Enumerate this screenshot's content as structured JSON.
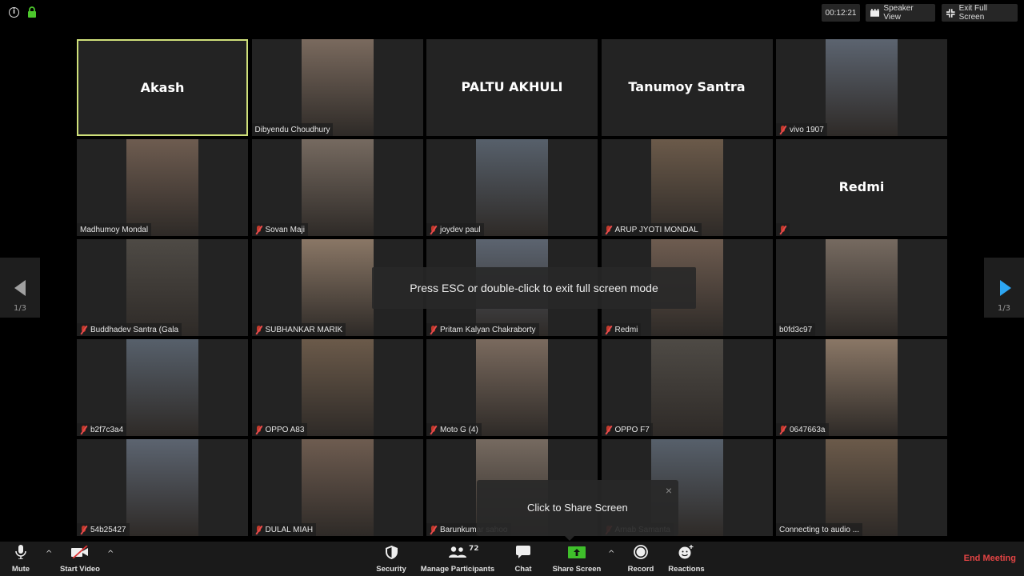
{
  "top_bar": {
    "info_icon": "info-icon",
    "lock_icon": "lock-icon",
    "timer": "00:12:21",
    "speaker_view_label": "Speaker View",
    "exit_full_screen_label": "Exit Full Screen"
  },
  "gallery": {
    "page_indicator_left": "1/3",
    "page_indicator_right": "1/3",
    "tiles": [
      {
        "name": "Akash",
        "video": false,
        "muted": false,
        "active_speaker": true
      },
      {
        "name": "Dibyendu Choudhury",
        "video": true,
        "muted": false
      },
      {
        "name": "PALTU AKHULI",
        "video": false,
        "muted": false
      },
      {
        "name": "Tanumoy Santra",
        "video": false,
        "muted": false
      },
      {
        "name": "vivo 1907",
        "video": true,
        "muted": true
      },
      {
        "name": "Madhumoy Mondal",
        "video": true,
        "muted": false
      },
      {
        "name": "Sovan Maji",
        "video": true,
        "muted": true
      },
      {
        "name": "joydev paul",
        "video": true,
        "muted": true
      },
      {
        "name": "ARUP JYOTI MONDAL",
        "video": true,
        "muted": true
      },
      {
        "name": "Redmi",
        "video": false,
        "muted": true
      },
      {
        "name": "Buddhadev Santra (Gala",
        "video": true,
        "muted": true
      },
      {
        "name": "SUBHANKAR MARIK",
        "video": true,
        "muted": true
      },
      {
        "name": "Pritam Kalyan Chakraborty",
        "video": true,
        "muted": true
      },
      {
        "name": "Redmi",
        "video": true,
        "muted": true
      },
      {
        "name": "b0fd3c97",
        "video": true,
        "muted": false
      },
      {
        "name": "b2f7c3a4",
        "video": true,
        "muted": true
      },
      {
        "name": "OPPO A83",
        "video": true,
        "muted": true
      },
      {
        "name": "Moto G (4)",
        "video": true,
        "muted": true
      },
      {
        "name": "OPPO F7",
        "video": true,
        "muted": true
      },
      {
        "name": "0647663a",
        "video": true,
        "muted": true
      },
      {
        "name": "54b25427",
        "video": true,
        "muted": true
      },
      {
        "name": "DULAL MIAH",
        "video": true,
        "muted": true
      },
      {
        "name": "Barunkumar sahoo",
        "video": true,
        "muted": true
      },
      {
        "name": "Arnab Samanta",
        "video": true,
        "muted": true
      },
      {
        "name": "Connecting to audio ...",
        "video": true,
        "muted": false
      }
    ]
  },
  "overlays": {
    "fullscreen_hint": "Press ESC or double-click to exit full screen mode",
    "share_tooltip": "Click to Share Screen",
    "share_tooltip_close": "×"
  },
  "toolbar": {
    "mute_label": "Mute",
    "start_video_label": "Start Video",
    "security_label": "Security",
    "manage_participants_label": "Manage Participants",
    "participant_count": "72",
    "chat_label": "Chat",
    "share_screen_label": "Share Screen",
    "record_label": "Record",
    "reactions_label": "Reactions",
    "end_meeting_label": "End Meeting",
    "caret": "^"
  },
  "colors": {
    "active_speaker_border": "#cfe07a",
    "share_green": "#3fbf2b",
    "end_meeting_red": "#e34444",
    "next_arrow_blue": "#2da6f2",
    "lock_green": "#4cc72c"
  }
}
